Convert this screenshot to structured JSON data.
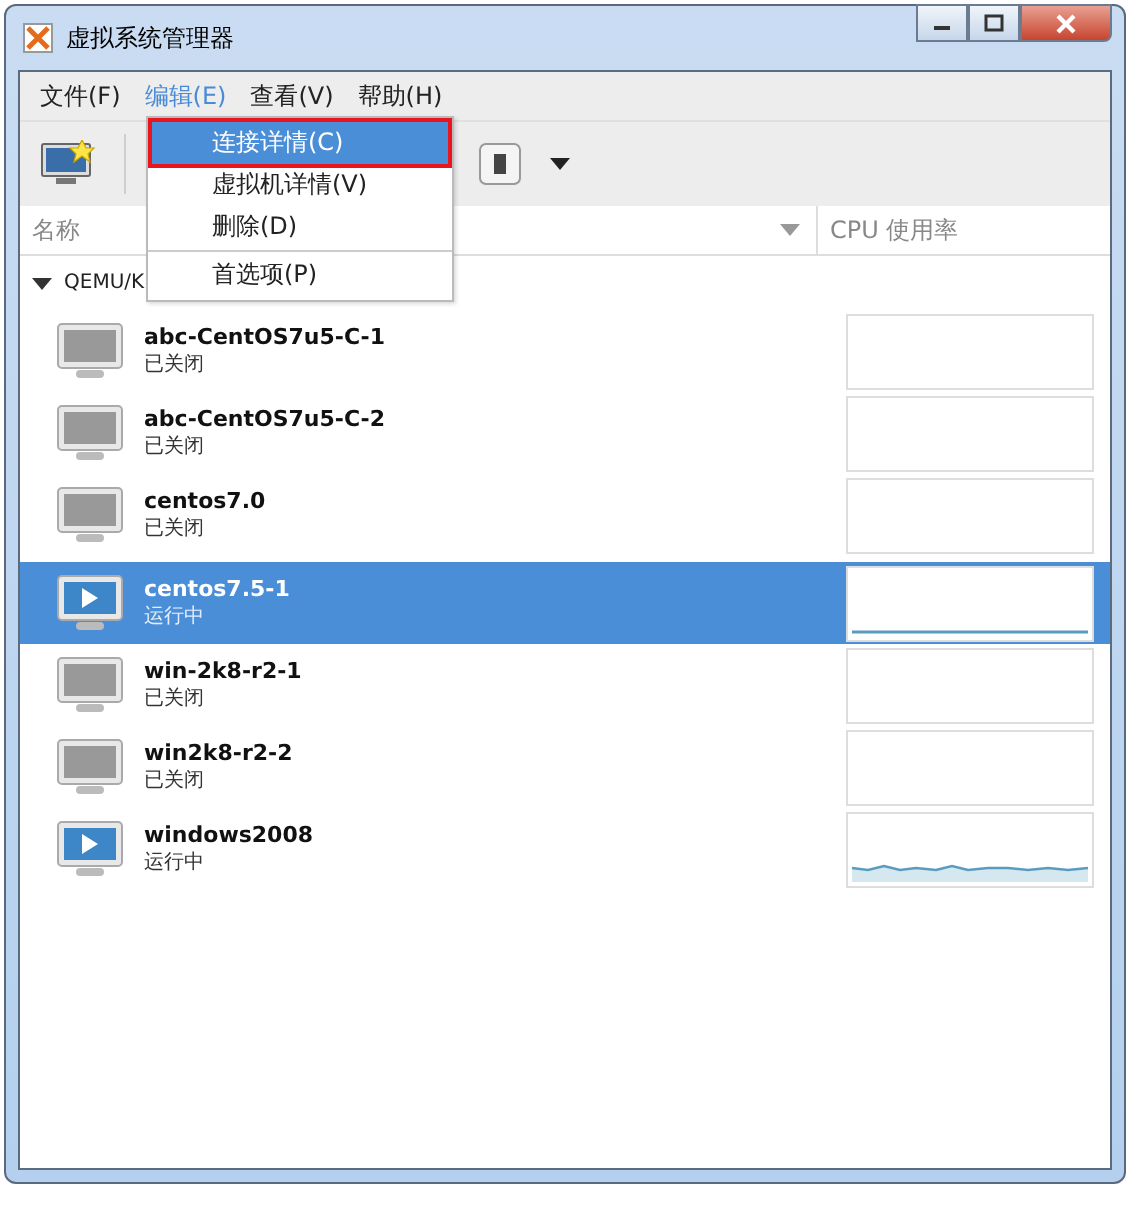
{
  "window": {
    "title": "虚拟系统管理器"
  },
  "menus": [
    {
      "label": "文件(F)",
      "selected": false
    },
    {
      "label": "编辑(E)",
      "selected": true
    },
    {
      "label": "查看(V)",
      "selected": false
    },
    {
      "label": "帮助(H)",
      "selected": false
    }
  ],
  "open_menu": {
    "sections": [
      [
        {
          "label": "连接详情(C)",
          "selected": true
        },
        {
          "label": "虚拟机详情(V)",
          "selected": false
        },
        {
          "label": "删除(D)",
          "selected": false
        }
      ],
      [
        {
          "label": "首选项(P)",
          "selected": false
        }
      ]
    ]
  },
  "table": {
    "columns": [
      "名称",
      "CPU 使用率"
    ],
    "group": {
      "label": "QEMU/K",
      "expanded": true
    },
    "rows": [
      {
        "name": "abc-CentOS7u5-C-1",
        "status": "已关闭",
        "kind": "shutoff",
        "selected": false
      },
      {
        "name": "abc-CentOS7u5-C-2",
        "status": "已关闭",
        "kind": "shutoff",
        "selected": false
      },
      {
        "name": "centos7.0",
        "status": "已关闭",
        "kind": "shutoff",
        "selected": false
      },
      {
        "name": "centos7.5-1",
        "status": "运行中",
        "kind": "running",
        "selected": true
      },
      {
        "name": "win-2k8-r2-1",
        "status": "已关闭",
        "kind": "shutoff",
        "selected": false
      },
      {
        "name": "win2k8-r2-2",
        "status": "已关闭",
        "kind": "shutoff",
        "selected": false
      },
      {
        "name": "windows2008",
        "status": "运行中",
        "kind": "running",
        "selected": false
      }
    ]
  }
}
